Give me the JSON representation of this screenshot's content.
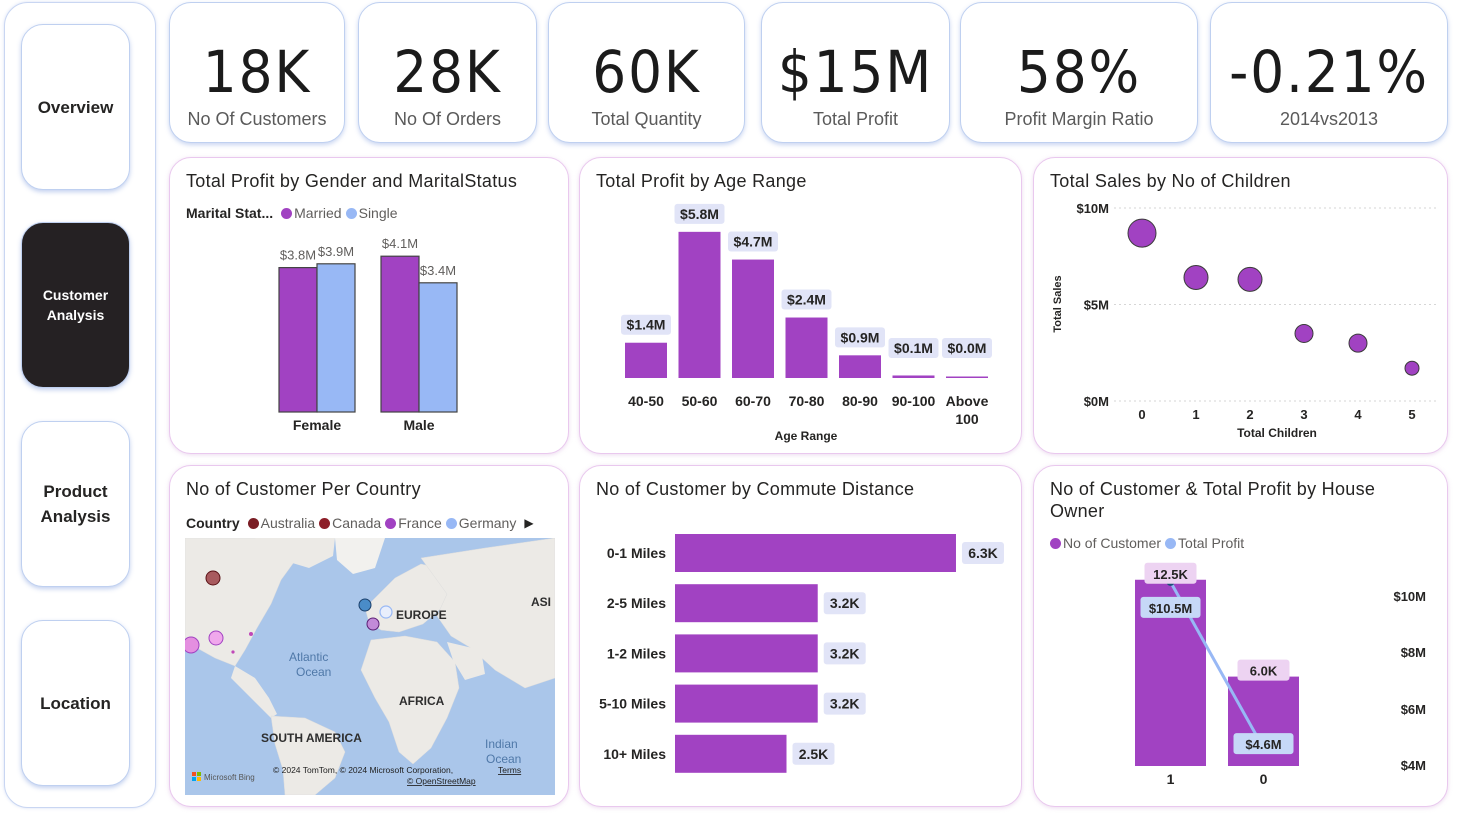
{
  "nav": {
    "overview": "Overview",
    "customer_line1": "Customer",
    "customer_line2": "Analysis",
    "product_line1": "Product",
    "product_line2": "Analysis",
    "location": "Location"
  },
  "kpis": [
    {
      "value": "18K",
      "label": "No Of Customers"
    },
    {
      "value": "28K",
      "label": "No Of Orders"
    },
    {
      "value": "60K",
      "label": "Total Quantity"
    },
    {
      "value": "$15M",
      "label": "Total Profit"
    },
    {
      "value": "58%",
      "label": "Profit Margin Ratio"
    },
    {
      "value": "-0.21%",
      "label": "2014vs2013"
    }
  ],
  "colors": {
    "married": "#a142c2",
    "single": "#98b8f5",
    "purple": "#a142c2",
    "dark_red": "#7a1d24",
    "nav_active": "#252123"
  },
  "chart_data": [
    {
      "type": "bar",
      "title": "Total Profit by Gender and MaritalStatus",
      "legend_title": "Marital Stat...",
      "categories": [
        "Female",
        "Male"
      ],
      "series": [
        {
          "name": "Married",
          "values": [
            3.8,
            4.1
          ],
          "labels": [
            "$3.8M",
            "$4.1M"
          ]
        },
        {
          "name": "Single",
          "values": [
            3.9,
            3.4
          ],
          "labels": [
            "$3.9M",
            "$3.4M"
          ]
        }
      ],
      "ylim": [
        0,
        4.5
      ]
    },
    {
      "type": "bar",
      "title": "Total Profit by Age Range",
      "xlabel": "Age Range",
      "categories": [
        "40-50",
        "50-60",
        "60-70",
        "70-80",
        "80-90",
        "90-100",
        "Above 100"
      ],
      "values": [
        1.4,
        5.8,
        4.7,
        2.4,
        0.9,
        0.1,
        0.0
      ],
      "labels": [
        "$1.4M",
        "$5.8M",
        "$4.7M",
        "$2.4M",
        "$0.9M",
        "$0.1M",
        "$0.0M"
      ]
    },
    {
      "type": "scatter",
      "title": "Total Sales by No of Children",
      "xlabel": "Total Children",
      "ylabel": "Total Sales",
      "x": [
        0,
        1,
        2,
        3,
        4,
        5
      ],
      "y": [
        8.7,
        6.4,
        6.3,
        3.5,
        3.0,
        1.7
      ],
      "yticks": [
        "$0M",
        "$5M",
        "$10M"
      ],
      "ylim": [
        0,
        10
      ]
    },
    {
      "type": "bar",
      "title": "No of Customer by Commute Distance",
      "categories": [
        "0-1 Miles",
        "2-5 Miles",
        "1-2 Miles",
        "5-10 Miles",
        "10+ Miles"
      ],
      "values": [
        6.3,
        3.2,
        3.2,
        3.2,
        2.5
      ],
      "labels": [
        "6.3K",
        "3.2K",
        "3.2K",
        "3.2K",
        "2.5K"
      ]
    },
    {
      "type": "bar",
      "title": "No of Customer & Total Profit by House Owner",
      "categories": [
        "1",
        "0"
      ],
      "series": [
        {
          "name": "No of Customer",
          "values": [
            12.5,
            6.0
          ],
          "labels": [
            "12.5K",
            "6.0K"
          ]
        },
        {
          "name": "Total Profit",
          "values": [
            10.5,
            4.6
          ],
          "labels": [
            "$10.5M",
            "$4.6M"
          ]
        }
      ],
      "y2ticks": [
        "$10M",
        "$8M",
        "$6M",
        "$4M"
      ]
    }
  ],
  "map": {
    "title": "No of Customer Per Country",
    "legend_title": "Country",
    "legend": [
      "Australia",
      "Canada",
      "France",
      "Germany"
    ],
    "labels": {
      "europe": "EUROPE",
      "asia": "ASI",
      "atlantic1": "Atlantic",
      "atlantic2": "Ocean",
      "africa": "AFRICA",
      "south_america": "SOUTH AMERICA",
      "indian1": "Indian",
      "indian2": "Ocean"
    },
    "brand": "Microsoft Bing",
    "copyright": "© 2024 TomTom, © 2024 Microsoft Corporation,",
    "terms": "Terms",
    "osm": "© OpenStreetMap"
  }
}
